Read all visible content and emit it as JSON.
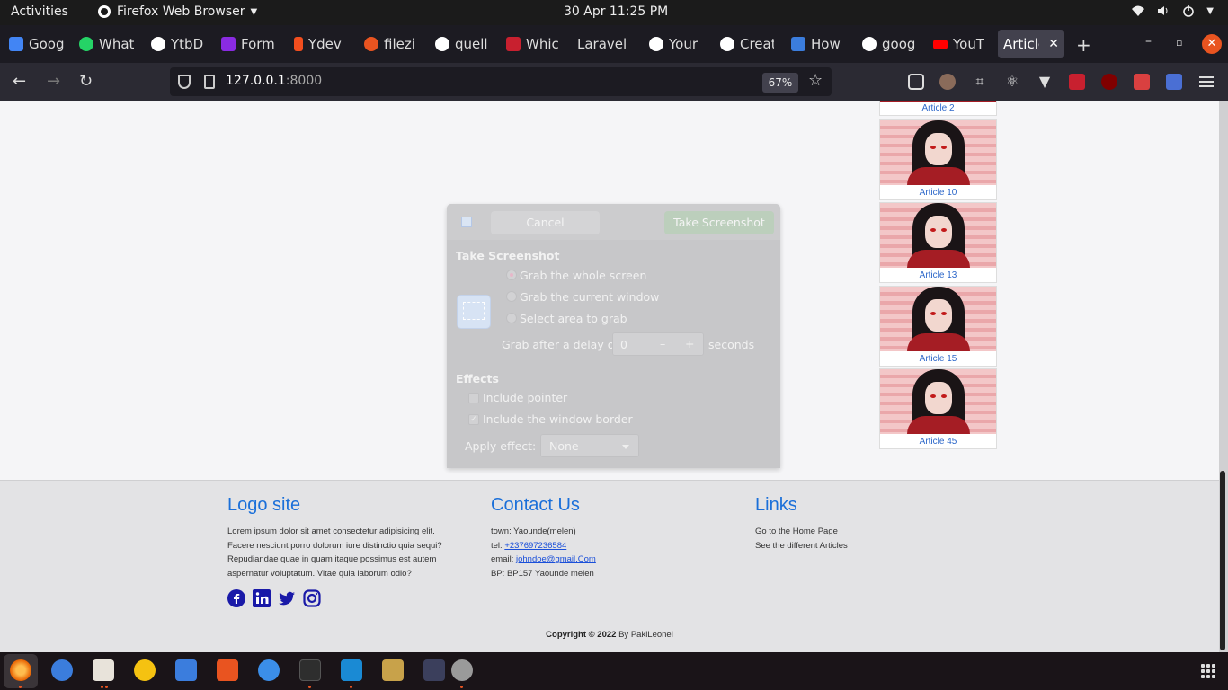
{
  "topbar": {
    "activities": "Activities",
    "app_name": "Firefox Web Browser",
    "clock": "30 Apr  11:25 PM"
  },
  "tabs": [
    {
      "title": "Goog",
      "color": "#4285f4"
    },
    {
      "title": "What",
      "color": "#25d366"
    },
    {
      "title": "YtbD",
      "color": "#ffffff"
    },
    {
      "title": "Form",
      "color": "#8a2be2"
    },
    {
      "title": "Ydev",
      "color": "#f24e1e"
    },
    {
      "title": "filezi",
      "color": "#e95420"
    },
    {
      "title": "quell",
      "color": "#ffffff"
    },
    {
      "title": "Whicl",
      "color": "#c8202f"
    },
    {
      "title": "Laravel",
      "color": "#1c1b22"
    },
    {
      "title": "Your",
      "color": "#ffffff"
    },
    {
      "title": "Creat",
      "color": "#ffffff"
    },
    {
      "title": "How",
      "color": "#3b7ddd"
    },
    {
      "title": "goog",
      "color": "#ffffff"
    },
    {
      "title": "YouT",
      "color": "#ff0000"
    },
    {
      "title": "Article",
      "color": "#42414d"
    }
  ],
  "navbar": {
    "url_host": "127.0.0.1",
    "url_port": ":8000",
    "zoom": "67%"
  },
  "articles": [
    {
      "label": "Article 2"
    },
    {
      "label": "Article 10"
    },
    {
      "label": "Article 13"
    },
    {
      "label": "Article 15"
    },
    {
      "label": "Article 45"
    }
  ],
  "footer": {
    "logo_title": "Logo site",
    "logo_text": "Lorem ipsum dolor sit amet consectetur adipisicing elit. Facere nesciunt porro dolorum iure distinctio quia sequi? Repudiandae quae in quam itaque possimus est autem aspernatur voluptatum. Vitae quia laborum odio?",
    "contact_title": "Contact Us",
    "town": "town: Yaounde(melen)",
    "tel_label": "tel: ",
    "tel": "+237697236584",
    "email_label": "email: ",
    "email": "johndoe@gmail.Com",
    "bp": "BP: BP157 Yaounde melen",
    "links_title": "Links",
    "link_home": "Go to the Home Page",
    "link_articles": "See the different Articles",
    "copyright_prefix": "Copyright © 2022",
    "copyright_by": " By PakiLeonel"
  },
  "dialog": {
    "cancel": "Cancel",
    "take": "Take Screenshot",
    "section_take": "Take Screenshot",
    "opt_whole": "Grab the whole screen",
    "opt_window": "Grab the current window",
    "opt_area": "Select area to grab",
    "delay_label": "Grab after a delay of",
    "delay_value": "0",
    "delay_unit": "seconds",
    "section_effects": "Effects",
    "include_pointer": "Include pointer",
    "include_border": "Include the window border",
    "apply_effect": "Apply effect:",
    "effect_value": "None"
  }
}
